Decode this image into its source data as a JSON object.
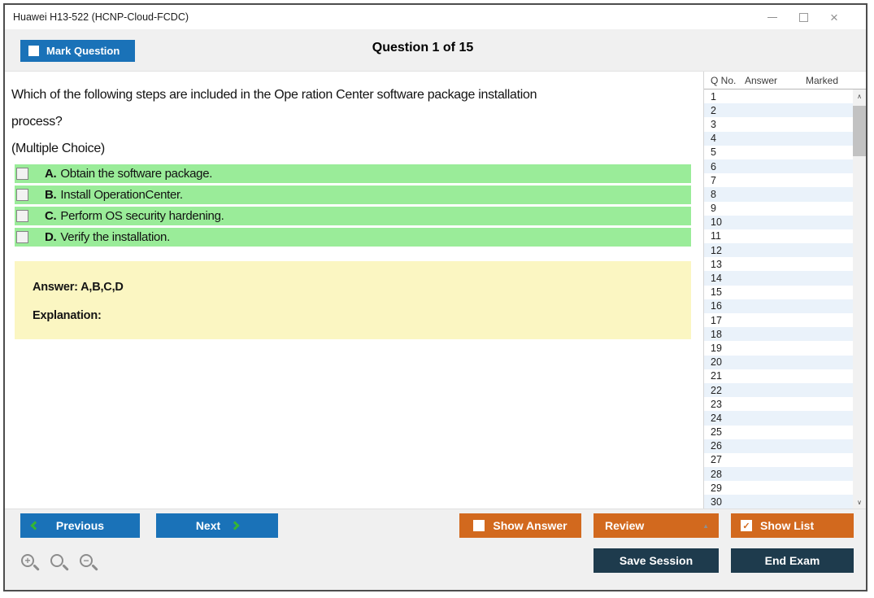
{
  "window": {
    "title": "Huawei H13-522 (HCNP-Cloud-FCDC)"
  },
  "icons": {
    "close": "×",
    "review_caret": "▲",
    "show_list_check": "✓",
    "scroll_up": "∧",
    "scroll_down": "∨",
    "zoom_in_sign": "+",
    "zoom_out_sign": "−"
  },
  "header": {
    "mark_question_label": "Mark Question",
    "question_counter": "Question 1 of 15"
  },
  "question": {
    "lines": [
      "Which of the following steps are included in the Ope ration Center software package installation",
      "process?",
      "(Multiple Choice)"
    ],
    "options": [
      {
        "letter": "A.",
        "text": "Obtain the software package."
      },
      {
        "letter": "B.",
        "text": "Install OperationCenter."
      },
      {
        "letter": "C.",
        "text": "Perform OS security hardening."
      },
      {
        "letter": "D.",
        "text": "Verify the installation."
      }
    ],
    "answer_label": "Answer: A,B,C,D",
    "explanation_label": "Explanation:"
  },
  "question_list": {
    "columns": [
      "Q No.",
      "Answer",
      "Marked"
    ],
    "rows": [
      {
        "q": "1",
        "answer": "",
        "marked": ""
      },
      {
        "q": "2",
        "answer": "",
        "marked": ""
      },
      {
        "q": "3",
        "answer": "",
        "marked": ""
      },
      {
        "q": "4",
        "answer": "",
        "marked": ""
      },
      {
        "q": "5",
        "answer": "",
        "marked": ""
      },
      {
        "q": "6",
        "answer": "",
        "marked": ""
      },
      {
        "q": "7",
        "answer": "",
        "marked": ""
      },
      {
        "q": "8",
        "answer": "",
        "marked": ""
      },
      {
        "q": "9",
        "answer": "",
        "marked": ""
      },
      {
        "q": "10",
        "answer": "",
        "marked": ""
      },
      {
        "q": "11",
        "answer": "",
        "marked": ""
      },
      {
        "q": "12",
        "answer": "",
        "marked": ""
      },
      {
        "q": "13",
        "answer": "",
        "marked": ""
      },
      {
        "q": "14",
        "answer": "",
        "marked": ""
      },
      {
        "q": "15",
        "answer": "",
        "marked": ""
      },
      {
        "q": "16",
        "answer": "",
        "marked": ""
      },
      {
        "q": "17",
        "answer": "",
        "marked": ""
      },
      {
        "q": "18",
        "answer": "",
        "marked": ""
      },
      {
        "q": "19",
        "answer": "",
        "marked": ""
      },
      {
        "q": "20",
        "answer": "",
        "marked": ""
      },
      {
        "q": "21",
        "answer": "",
        "marked": ""
      },
      {
        "q": "22",
        "answer": "",
        "marked": ""
      },
      {
        "q": "23",
        "answer": "",
        "marked": ""
      },
      {
        "q": "24",
        "answer": "",
        "marked": ""
      },
      {
        "q": "25",
        "answer": "",
        "marked": ""
      },
      {
        "q": "26",
        "answer": "",
        "marked": ""
      },
      {
        "q": "27",
        "answer": "",
        "marked": ""
      },
      {
        "q": "28",
        "answer": "",
        "marked": ""
      },
      {
        "q": "29",
        "answer": "",
        "marked": ""
      },
      {
        "q": "30",
        "answer": "",
        "marked": ""
      }
    ]
  },
  "footer": {
    "previous_label": "Previous",
    "next_label": "Next",
    "show_answer_label": "Show Answer",
    "review_label": "Review",
    "show_list_label": "Show List",
    "save_session_label": "Save Session",
    "end_exam_label": "End Exam"
  },
  "colors": {
    "accent_blue": "#1a72b8",
    "accent_orange": "#d2691e",
    "accent_navy": "#1e3b4d",
    "option_green": "#9aec99",
    "answer_yellow": "#fbf6c2",
    "row_alt_blue": "#eaf2fa",
    "chevron_green": "#35b535"
  }
}
